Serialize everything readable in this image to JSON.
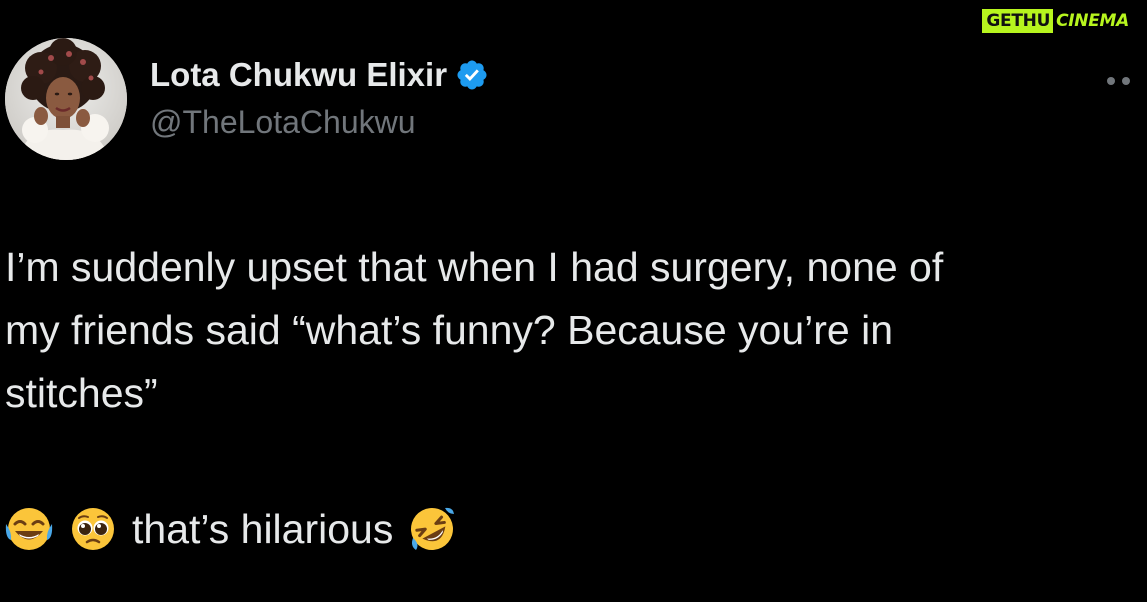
{
  "watermark": {
    "part1": "GETHU",
    "part2": "CINEMA",
    "accent_color": "#b7f51e"
  },
  "post": {
    "author": {
      "display_name": "Lota Chukwu Elixir",
      "handle": "@TheLotaChukwu",
      "verified": true,
      "verified_color": "#1d9bf0",
      "avatar_icon": "profile-photo"
    },
    "more_icon": "more-options-icon",
    "text": "I’m suddenly upset that when I had surgery, none of\nmy friends said “what’s funny? Because you’re in\nstitches”",
    "reaction_text": "that’s hilarious",
    "emojis_before": [
      "face-with-tears-of-joy",
      "pleading-face"
    ],
    "emojis_after": [
      "rolling-on-the-floor-laughing"
    ]
  },
  "colors": {
    "background": "#000000",
    "primary_text": "#e7e9ea",
    "secondary_text": "#71767b"
  }
}
